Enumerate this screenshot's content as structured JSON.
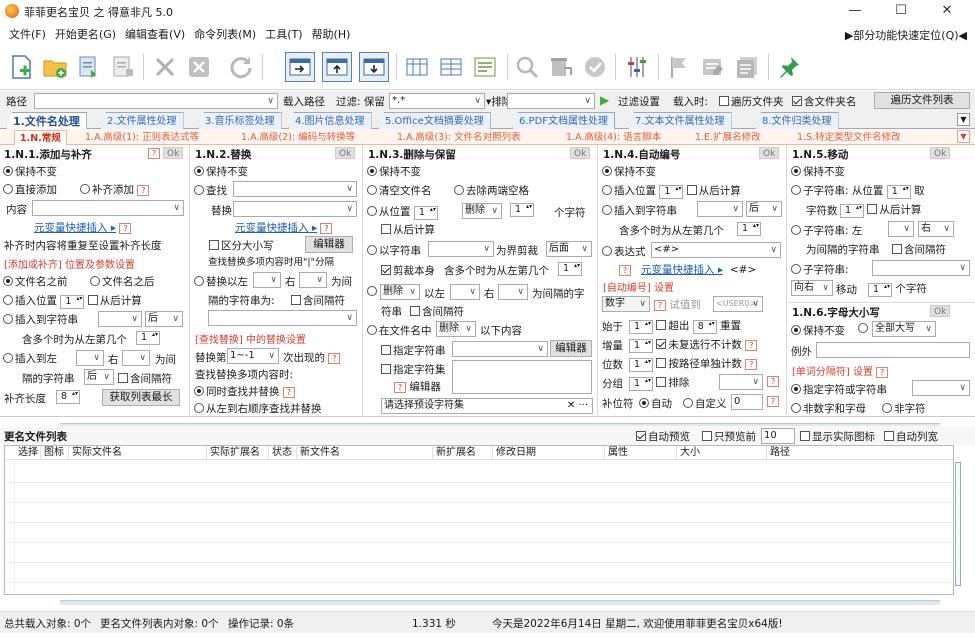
{
  "window": {
    "title": "菲菲更名宝贝 之 得意非凡 5.0",
    "min": "—",
    "max": "☐",
    "close": "✕"
  },
  "menu": {
    "items": [
      "文件(F)",
      "开始更名(G)",
      "编辑查看(V)",
      "命令列表(M)",
      "工具(T)",
      "帮助(H)"
    ],
    "quick_locate": "▶部分功能快速定位(Q)◀"
  },
  "pathrow": {
    "path_label": "路径",
    "load_path": "载入路径",
    "filter_label": "过滤: 保留",
    "filter_value": "*.*",
    "exclude_label": "▾排除",
    "filter_settings": "过滤设置",
    "load_time_label": "载入时:",
    "traverse_folders": "遍历文件夹",
    "include_folder_names": "含文件夹名",
    "traverse_list": "遍历文件列表"
  },
  "tabs_main": [
    "1.文件名处理",
    "2.文件属性处理",
    "3.音乐标签处理",
    "4.图片信息处理",
    "5.Office文档摘要处理",
    "6.PDF文档属性处理",
    "7.文本文件属性处理",
    "8.文件归类处理"
  ],
  "tabs_sub": [
    "1.N.常规",
    "1.A.高级(1): 正则表达式等",
    "1.A.高级(2): 编码与转换等",
    "1.A.高级(3): 文件名对照列表",
    "1.A.高级(4): 语言脚本",
    "1.E.扩展名修改",
    "1.S.特定类型文件名修改"
  ],
  "col1": {
    "title": "1.N.1.添加与补齐",
    "ok": "Ok",
    "keep": "保持不变",
    "direct_add": "直接添加",
    "pad_add": "补齐添加",
    "content": "内容",
    "varlink": "元变量快捷插入 ▸",
    "pad_repeat": "补齐时内容将重复至设置补齐长度",
    "section": "[添加或补齐] 位置及参数设置",
    "before_name": "文件名之前",
    "after_name": "文件名之后",
    "insert_pos": "插入位置",
    "insert_val": "1",
    "from_end": "从后计算",
    "insert_to_str": "插入到字符串",
    "after_opt": "后",
    "nth_label": "含多个时为从左第几个",
    "nth_val": "1",
    "insert_between": "插入到左",
    "right_lbl": "右",
    "between_lbl": "为间",
    "gap_str": "隔的字符串",
    "after2": "后",
    "include_gap": "含间隔符",
    "pad_len": "补齐长度",
    "pad_val": "8",
    "get_max": "获取列表最长"
  },
  "col2": {
    "title": "1.N.2.替换",
    "ok": "Ok",
    "keep": "保持不变",
    "find": "查找",
    "replace": "替换",
    "varlink": "元变量快捷插入 ▸",
    "case": "区分大小写",
    "editor": "编辑器",
    "multi_hint": "查找替换多项内容时用\"|\"分隔",
    "replace_with_left": "替换以左",
    "right_lbl": "右",
    "between_lbl": "为间",
    "gap_str": "隔的字符串为:",
    "include_gap": "含间隔符",
    "section": "[查找替换] 中的替换设置",
    "nth_replace": "替换第",
    "nth_val": "1~-1",
    "nth_suffix": "次出现的",
    "multi_find": "查找替换多项内容时:",
    "simul": "同时查找并替换",
    "seq": "从左到右顺序查找并替换"
  },
  "col3": {
    "title": "1.N.3.删除与保留",
    "ok": "Ok",
    "keep": "保持不变",
    "clear": "清空文件名",
    "trim": "去除两端空格",
    "from_pos": "从位置",
    "pos_val": "1",
    "del_opt": "删除",
    "cnt_val": "1",
    "chars": "个字符",
    "from_end": "从后计算",
    "with_str": "以字符串",
    "as_border": "为界剪裁",
    "after_opt": "后面",
    "cut_self": "剪裁本身",
    "nth_label": "含多个时为从左第几个",
    "nth_val": "1",
    "del_opt2": "删除",
    "with_left": "以左",
    "right_lbl": "右",
    "gap_str": "为间隔的字",
    "str_lbl": "符串",
    "include_gap": "含间隔符",
    "in_name": "在文件名中",
    "del_opt3": "删除",
    "below": "以下内容",
    "spec_str": "指定字符串",
    "editor": "编辑器",
    "spec_set": "指定字符集",
    "editor2": "编辑器",
    "preset": "请选择预设字符集"
  },
  "col4": {
    "title": "1.N.4.自动编号",
    "ok": "Ok",
    "keep": "保持不变",
    "insert_pos": "插入位置",
    "pos_val": "1",
    "from_end": "从后计算",
    "insert_to_str": "插入到字符串",
    "after_opt": "后",
    "nth_label": "含多个时为从左第几个",
    "nth_val": "1",
    "expr": "表达式",
    "expr_val": "<#>",
    "varlink": "元变量快捷插入 ▸",
    "expr_tag": "<#>",
    "section": "[自动编号] 设置",
    "digit": "数字",
    "try": "试值到",
    "user": "<USER0>",
    "start": "始于",
    "start_val": "1",
    "over": "超出",
    "over_val": "8",
    "reset": "重置",
    "inc": "增量",
    "inc_val": "1",
    "uncount": "未复选行不计数",
    "digits": "位数",
    "digits_val": "1",
    "per_path": "按路径单独计数",
    "group": "分组",
    "group_val": "1",
    "exclude": "排除",
    "pad_char": "补位符",
    "auto": "自动",
    "custom": "自定义",
    "custom_val": "0"
  },
  "col5": {
    "title": "1.N.5.移动",
    "ok": "Ok",
    "keep": "保持不变",
    "substr": "子字符串: 从位置",
    "substr_val": "1",
    "take": "取",
    "char_cnt": "字符数",
    "char_val": "1",
    "from_end": "从后计算",
    "substr2": "子字符串: 左",
    "right_lbl": "右",
    "gap_str": "为间隔的字符串",
    "include_gap": "含间隔符",
    "substr3": "子字符串:",
    "direction": "向右",
    "move": "移动",
    "move_val": "1",
    "move_unit": "个字符",
    "title2": "1.N.6.字母大小写",
    "ok2": "Ok",
    "keep2": "保持不变",
    "all_upper": "全部大写",
    "exception": "例外",
    "section": "[单词分隔符] 设置",
    "spec_char": "指定字符或字符串",
    "non_alnum": "非数字和字母",
    "non_char": "非字符"
  },
  "list": {
    "title": "更名文件列表",
    "auto_preview": "自动预览",
    "preview_first": "只预览前",
    "preview_val": "10",
    "show_icons": "显示实际图标",
    "auto_width": "自动列宽",
    "columns": [
      "选择",
      "图标",
      "实际文件名",
      "实际扩展名",
      "状态",
      "新文件名",
      "新扩展名",
      "修改日期",
      "属性",
      "大小",
      "路径"
    ]
  },
  "status": {
    "loaded": "总共载入对象: 0个",
    "list_count": "更名文件列表内对象: 0个",
    "ops": "操作记录: 0条",
    "time": "1.331 秒",
    "welcome": "今天是2022年6月14日 星期二, 欢迎使用菲菲更名宝贝x64版!"
  },
  "colors": {
    "tab_blue": "#3a6aa8",
    "tab_orange": "#e06040",
    "help_red": "#d04030"
  }
}
